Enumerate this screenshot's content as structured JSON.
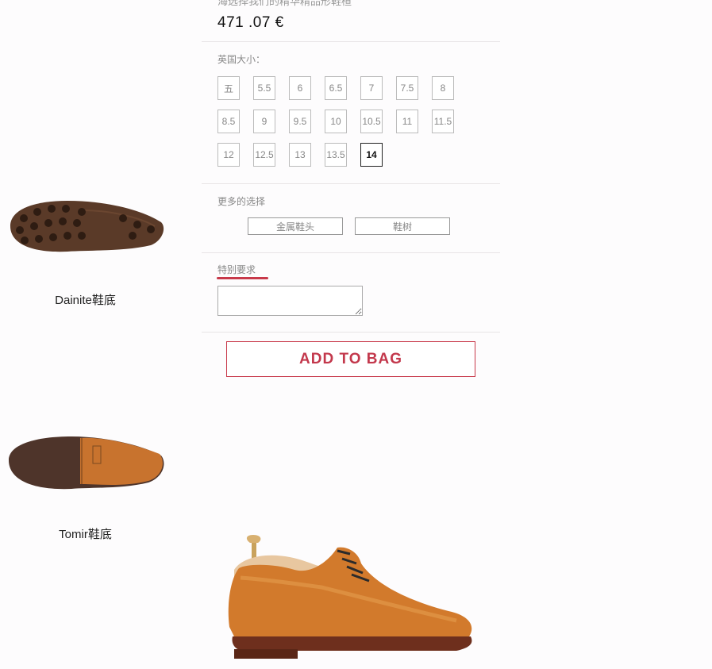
{
  "header": {
    "cut_text": "海选择我们的精华精品形鞋楦",
    "price": "471 .07 €"
  },
  "sizes": {
    "label": "英国大小：",
    "options": [
      "五",
      "5.5",
      "6",
      "6.5",
      "7",
      "7.5",
      "8",
      "8.5",
      "9",
      "9.5",
      "10",
      "10.5",
      "11",
      "11.5",
      "12",
      "12.5",
      "13",
      "13.5",
      "14"
    ],
    "selected": "14"
  },
  "extras": {
    "label": "更多的选择",
    "options": [
      "金属鞋头",
      "鞋树"
    ]
  },
  "special": {
    "label": "特别要求",
    "textarea_value": ""
  },
  "cta": {
    "label": "ADD TO BAG"
  },
  "soles": [
    {
      "caption": "Dainite鞋底"
    },
    {
      "caption": "Tomir鞋底"
    }
  ],
  "colors": {
    "accent": "#c3384c",
    "sole_dark": "#5a3a28",
    "shoe_leather": "#d27a2c"
  }
}
